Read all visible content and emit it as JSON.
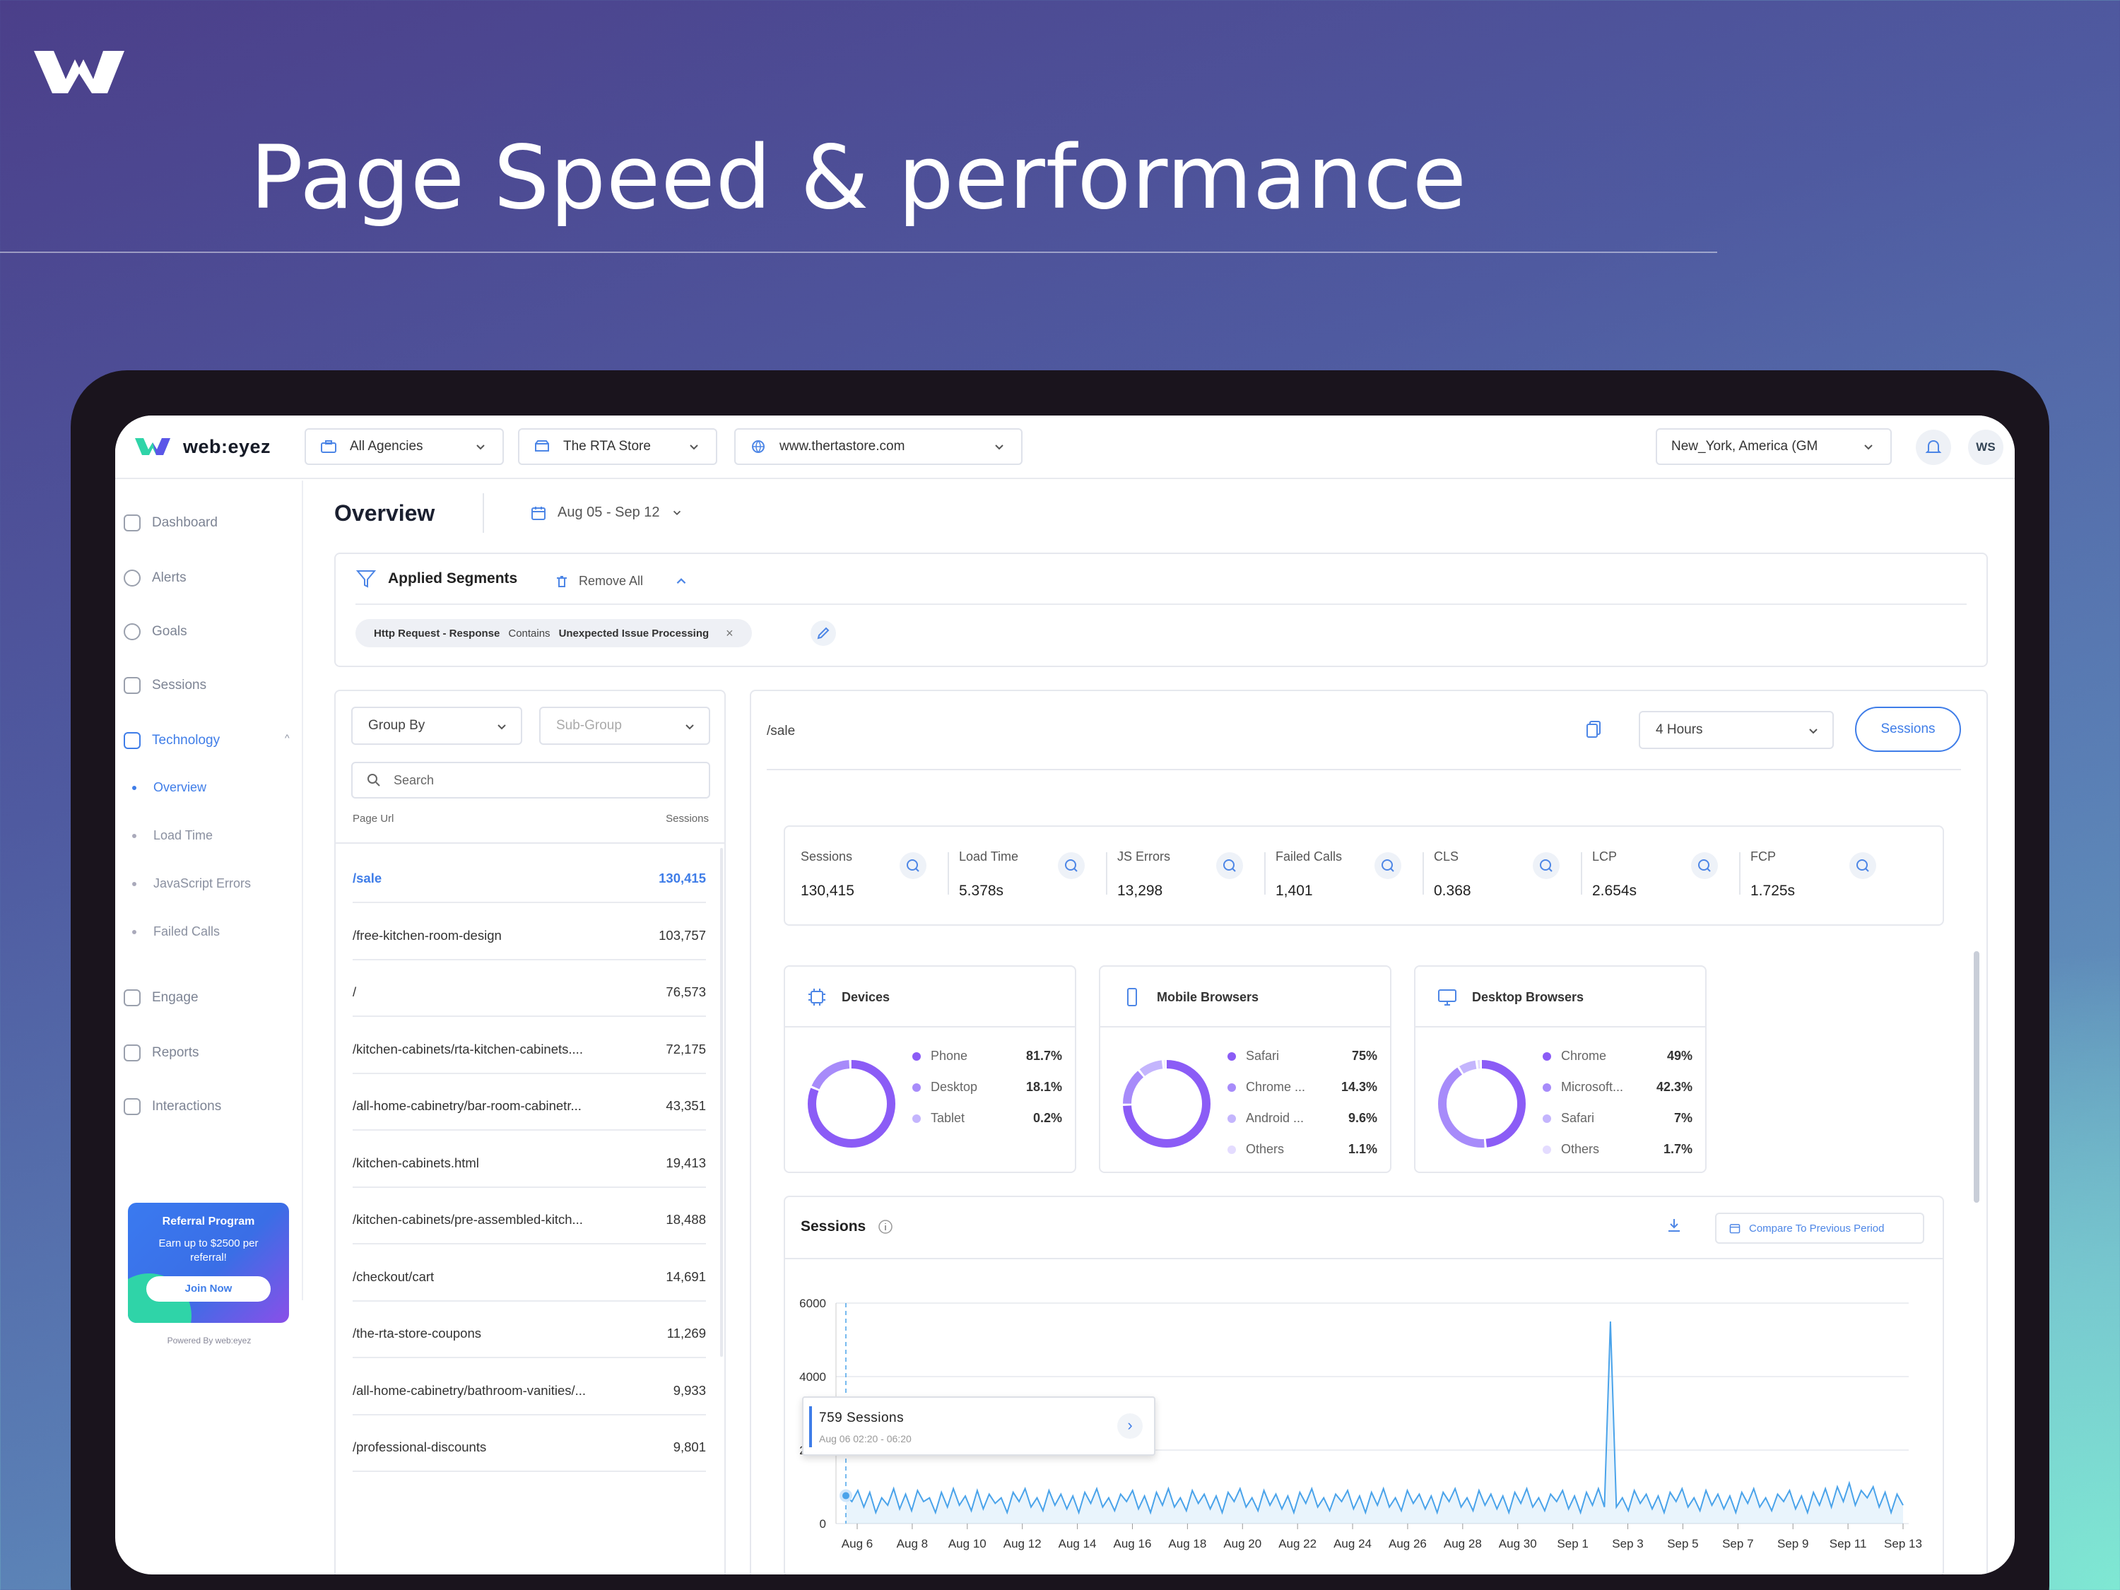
{
  "headline": "Page Speed & performance",
  "topbar": {
    "brand": "web:eyez",
    "agency": "All Agencies",
    "store": "The RTA Store",
    "site": "www.thertastore.com",
    "timezone": "New_York, America (GM",
    "user_initials": "WS"
  },
  "sidebar": {
    "items": [
      {
        "label": "Dashboard"
      },
      {
        "label": "Alerts"
      },
      {
        "label": "Goals"
      },
      {
        "label": "Sessions"
      },
      {
        "label": "Technology"
      },
      {
        "label": "Engage"
      },
      {
        "label": "Reports"
      },
      {
        "label": "Interactions"
      }
    ],
    "tech_sub": [
      "Overview",
      "Load Time",
      "JavaScript Errors",
      "Failed Calls"
    ],
    "referral": {
      "title": "Referral Program",
      "text": "Earn up to $2500 per referral!",
      "button": "Join Now"
    },
    "powered": "Powered By web:eyez"
  },
  "header": {
    "title": "Overview",
    "date": "Aug 05 - Sep 12"
  },
  "segments": {
    "title": "Applied Segments",
    "remove": "Remove All",
    "chip_a": "Http Request - Response",
    "chip_b": "Contains",
    "chip_c": "Unexpected Issue Processing"
  },
  "list": {
    "group_by": "Group By",
    "sub_group": "Sub-Group",
    "search_placeholder": "Search",
    "col_url": "Page Url",
    "col_sessions": "Sessions",
    "rows": [
      {
        "url": "/sale",
        "sessions": "130,415"
      },
      {
        "url": "/free-kitchen-room-design",
        "sessions": "103,757"
      },
      {
        "url": "/",
        "sessions": "76,573"
      },
      {
        "url": "/kitchen-cabinets/rta-kitchen-cabinets....",
        "sessions": "72,175"
      },
      {
        "url": "/all-home-cabinetry/bar-room-cabinetr...",
        "sessions": "43,351"
      },
      {
        "url": "/kitchen-cabinets.html",
        "sessions": "19,413"
      },
      {
        "url": "/kitchen-cabinets/pre-assembled-kitch...",
        "sessions": "18,488"
      },
      {
        "url": "/checkout/cart",
        "sessions": "14,691"
      },
      {
        "url": "/the-rta-store-coupons",
        "sessions": "11,269"
      },
      {
        "url": "/all-home-cabinetry/bathroom-vanities/...",
        "sessions": "9,933"
      },
      {
        "url": "/professional-discounts",
        "sessions": "9,801"
      }
    ]
  },
  "detail": {
    "page": "/sale",
    "range": "4 Hours",
    "sessions_btn": "Sessions"
  },
  "metrics": [
    {
      "label": "Sessions",
      "value": "130,415"
    },
    {
      "label": "Load Time",
      "value": "5.378s"
    },
    {
      "label": "JS Errors",
      "value": "13,298"
    },
    {
      "label": "Failed Calls",
      "value": "1,401"
    },
    {
      "label": "CLS",
      "value": "0.368"
    },
    {
      "label": "LCP",
      "value": "2.654s"
    },
    {
      "label": "FCP",
      "value": "1.725s"
    }
  ],
  "breakdowns": [
    {
      "title": "Devices",
      "items": [
        {
          "name": "Phone",
          "pct": "81.7%",
          "value": 81.7,
          "color": "#8b5cf6"
        },
        {
          "name": "Desktop",
          "pct": "18.1%",
          "value": 18.1,
          "color": "#a78bfa"
        },
        {
          "name": "Tablet",
          "pct": "0.2%",
          "value": 0.2,
          "color": "#c4b5fd"
        }
      ]
    },
    {
      "title": "Mobile Browsers",
      "items": [
        {
          "name": "Safari",
          "pct": "75%",
          "value": 75,
          "color": "#8b5cf6"
        },
        {
          "name": "Chrome ...",
          "pct": "14.3%",
          "value": 14.3,
          "color": "#a78bfa"
        },
        {
          "name": "Android ...",
          "pct": "9.6%",
          "value": 9.6,
          "color": "#c4b5fd"
        },
        {
          "name": "Others",
          "pct": "1.1%",
          "value": 1.1,
          "color": "#e4dcff"
        }
      ]
    },
    {
      "title": "Desktop Browsers",
      "items": [
        {
          "name": "Chrome",
          "pct": "49%",
          "value": 49,
          "color": "#8b5cf6"
        },
        {
          "name": "Microsoft...",
          "pct": "42.3%",
          "value": 42.3,
          "color": "#a78bfa"
        },
        {
          "name": "Safari",
          "pct": "7%",
          "value": 7,
          "color": "#c4b5fd"
        },
        {
          "name": "Others",
          "pct": "1.7%",
          "value": 1.7,
          "color": "#e4dcff"
        }
      ]
    }
  ],
  "sessions_chart": {
    "title": "Sessions",
    "compare": "Compare To Previous Period",
    "tooltip_title": "759 Sessions",
    "tooltip_sub": "Aug 06 02:20 - 06:20"
  },
  "chart_data": {
    "type": "area",
    "title": "Sessions",
    "ylim": [
      0,
      6000
    ],
    "yticks": [
      "6000",
      "4000",
      "2000",
      "0"
    ],
    "xticks": [
      "Aug 6",
      "Aug 8",
      "Aug 10",
      "Aug 12",
      "Aug 14",
      "Aug 16",
      "Aug 18",
      "Aug 20",
      "Aug 22",
      "Aug 24",
      "Aug 26",
      "Aug 28",
      "Aug 30",
      "Sep 1",
      "Sep 3",
      "Sep 5",
      "Sep 7",
      "Sep 9",
      "Sep 11",
      "Sep 13"
    ],
    "series": [
      {
        "values": [
          759,
          600,
          900,
          450,
          850,
          300,
          700,
          500,
          950,
          400,
          800,
          350,
          900,
          600,
          700,
          300,
          850,
          450,
          950,
          500,
          750,
          350,
          900,
          400,
          800,
          550,
          700,
          300,
          850,
          600,
          950,
          450,
          700,
          350,
          900,
          500,
          800,
          400,
          750,
          300,
          850,
          550,
          950,
          450,
          700,
          350,
          800,
          600,
          900,
          400,
          750,
          300,
          850,
          500,
          950,
          450,
          700,
          350,
          900,
          550,
          800,
          400,
          750,
          300,
          850,
          600,
          950,
          450,
          700,
          350,
          900,
          500,
          800,
          400,
          750,
          300,
          850,
          550,
          950,
          450,
          700,
          350,
          800,
          600,
          900,
          400,
          750,
          300,
          850,
          500,
          950,
          450,
          700,
          350,
          900,
          550,
          800,
          400,
          750,
          300,
          850,
          600,
          950,
          450,
          700,
          350,
          900,
          500,
          800,
          400,
          750,
          300,
          850,
          550,
          950,
          450,
          700,
          350,
          800,
          600,
          900,
          400,
          750,
          300,
          850,
          500,
          950,
          450,
          5500,
          450,
          700,
          350,
          900,
          550,
          800,
          400,
          750,
          300,
          850,
          600,
          950,
          450,
          700,
          350,
          900,
          500,
          800,
          400,
          750,
          300,
          850,
          550,
          950,
          450,
          700,
          350,
          800,
          600,
          900,
          400,
          750,
          300,
          850,
          500,
          950,
          450,
          1000,
          600,
          1100,
          500,
          900,
          700,
          1000,
          450,
          850,
          300,
          800,
          500
        ]
      }
    ]
  },
  "colors": {
    "accent": "#3f7de8",
    "line": "#4aa3ea",
    "donut_primary": "#8b5cf6"
  }
}
